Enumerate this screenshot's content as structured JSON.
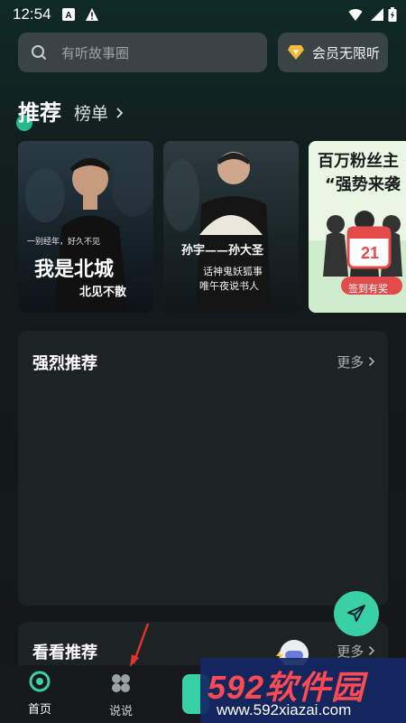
{
  "status": {
    "time": "12:54"
  },
  "search": {
    "placeholder": "有听故事圈"
  },
  "vip": {
    "label": "会员无限听"
  },
  "tabs": [
    "推荐",
    "榜单"
  ],
  "banners": [
    {
      "line1": "一别经年，好久不见",
      "title": "我是北城",
      "subtitle": "北见不散"
    },
    {
      "title": "孙宇——孙大圣",
      "line1": "话神鬼妖狐事",
      "line2": "唯午夜说书人"
    },
    {
      "title": "百万粉丝主",
      "line1": "“强势来袭",
      "calendar": "21",
      "badge": "签到有奖"
    }
  ],
  "sections": [
    {
      "title": "强烈推荐",
      "more": "更多"
    },
    {
      "title": "看看推荐",
      "more": "更多"
    }
  ],
  "tabbar": [
    {
      "label": "首页"
    },
    {
      "label": "说说"
    }
  ],
  "watermark": {
    "main": "592软件园",
    "sub": "www.592xiazai.com"
  }
}
